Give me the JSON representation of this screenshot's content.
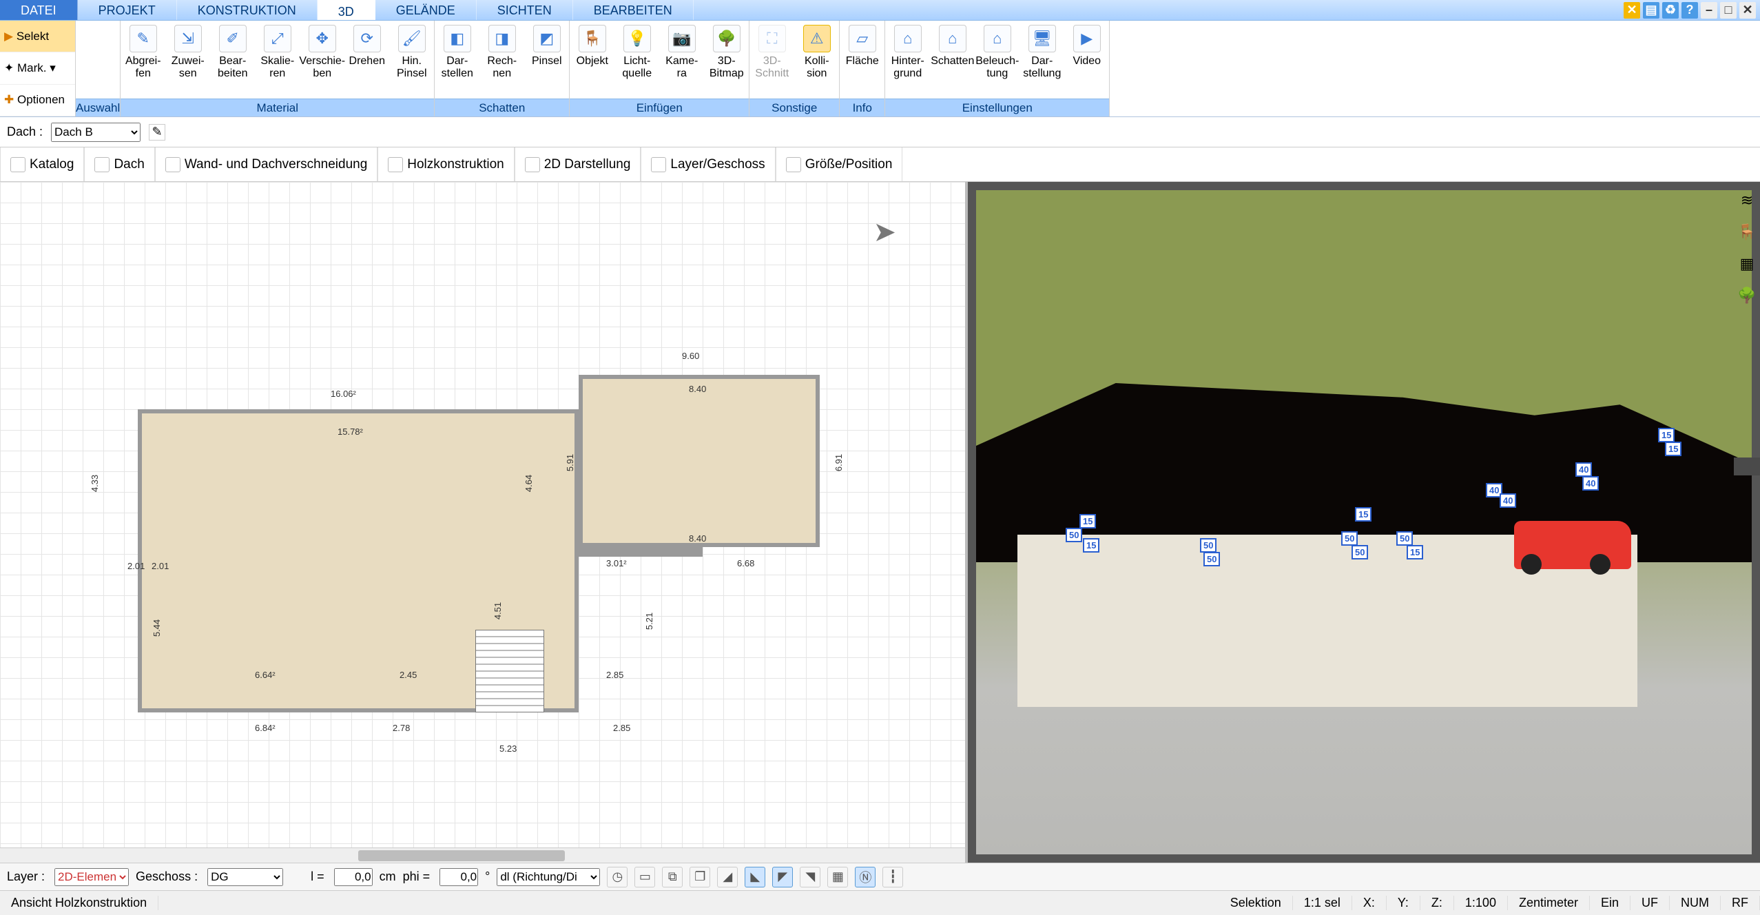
{
  "menu": {
    "tabs": [
      "DATEI",
      "PROJEKT",
      "KONSTRUKTION",
      "3D",
      "GELÄNDE",
      "SICHTEN",
      "BEARBEITEN"
    ],
    "active": 3
  },
  "lead": {
    "selekt": "Selekt",
    "mark": "Mark.",
    "opt": "Optionen"
  },
  "ribbon": {
    "groups": [
      {
        "title": "Auswahl",
        "buttons": []
      },
      {
        "title": "Material",
        "buttons": [
          {
            "lbl": "Abgrei-\nfen",
            "ic": "✎"
          },
          {
            "lbl": "Zuwei-\nsen",
            "ic": "⇲"
          },
          {
            "lbl": "Bear-\nbeiten",
            "ic": "✐"
          },
          {
            "lbl": "Skalie-\nren",
            "ic": "⤢"
          },
          {
            "lbl": "Verschie-\nben",
            "ic": "✥"
          },
          {
            "lbl": "Drehen",
            "ic": "⟳"
          },
          {
            "lbl": "Hin.\nPinsel",
            "ic": "🖌"
          }
        ]
      },
      {
        "title": "Schatten",
        "buttons": [
          {
            "lbl": "Dar-\nstellen",
            "ic": "◧"
          },
          {
            "lbl": "Rech-\nnen",
            "ic": "◨"
          },
          {
            "lbl": "Pinsel",
            "ic": "◩"
          }
        ]
      },
      {
        "title": "Einfügen",
        "buttons": [
          {
            "lbl": "Objekt",
            "ic": "🪑"
          },
          {
            "lbl": "Licht-\nquelle",
            "ic": "💡"
          },
          {
            "lbl": "Kame-\nra",
            "ic": "📷"
          },
          {
            "lbl": "3D-\nBitmap",
            "ic": "🌳"
          }
        ]
      },
      {
        "title": "Sonstige",
        "buttons": [
          {
            "lbl": "3D-\nSchnitt",
            "ic": "⛶",
            "dis": true
          },
          {
            "lbl": "Kolli-\nsion",
            "ic": "⚠",
            "active": true
          }
        ]
      },
      {
        "title": "Info",
        "buttons": [
          {
            "lbl": "Fläche",
            "ic": "▱"
          }
        ]
      },
      {
        "title": "Einstellungen",
        "buttons": [
          {
            "lbl": "Hinter-\ngrund",
            "ic": "⌂"
          },
          {
            "lbl": "Schatten",
            "ic": "⌂"
          },
          {
            "lbl": "Beleuch-\ntung",
            "ic": "⌂"
          },
          {
            "lbl": "Dar-\nstellung",
            "ic": "🖥"
          },
          {
            "lbl": "Video",
            "ic": "▶"
          }
        ]
      }
    ]
  },
  "elbar": {
    "label": "Dach :",
    "value": "Dach B"
  },
  "tabs": [
    {
      "lbl": "Katalog"
    },
    {
      "lbl": "Dach"
    },
    {
      "lbl": "Wand- und Dachverschneidung"
    },
    {
      "lbl": "Holzkonstruktion"
    },
    {
      "lbl": "2D Darstellung"
    },
    {
      "lbl": "Layer/Geschoss"
    },
    {
      "lbl": "Größe/Position"
    }
  ],
  "dims": {
    "d1": "9.60",
    "d2": "8.40",
    "d3": "8.40",
    "d4": "16.06²",
    "d5": "15.78²",
    "d6": "2.01",
    "d7": "3.01²",
    "d8": "6.68",
    "d9": "6.84²",
    "d10": "2.78",
    "d11": "2.85",
    "d12": "2.85",
    "d13": "5.23",
    "d14": "2.45",
    "d15": "4.51",
    "d16": "5.21",
    "d17": "5.91",
    "d18": "6.91",
    "d19": "6.64²",
    "d20": "4.33",
    "d21": "5.44",
    "d22": "4.64",
    "d23": "2.01"
  },
  "badges": [
    "50",
    "15",
    "50",
    "50",
    "50",
    "50",
    "50",
    "15",
    "40",
    "40",
    "40",
    "40",
    "15",
    "15",
    "15",
    "15"
  ],
  "bottom": {
    "layer_lbl": "Layer :",
    "layer_val": "2D-Elemen",
    "geschoss_lbl": "Geschoss :",
    "geschoss_val": "DG",
    "l_lbl": "l =",
    "l_val": "0,0",
    "l_unit": "cm",
    "phi_lbl": "phi =",
    "phi_val": "0,0",
    "phi_unit": "°",
    "mode": "dl (Richtung/Di"
  },
  "status": {
    "view": "Ansicht Holzkonstruktion",
    "sel": "Selektion",
    "ratio": "1:1 sel",
    "x": "X:",
    "y": "Y:",
    "z": "Z:",
    "scale": "1:100",
    "unit": "Zentimeter",
    "ein": "Ein",
    "uf": "UF",
    "num": "NUM",
    "rf": "RF"
  }
}
